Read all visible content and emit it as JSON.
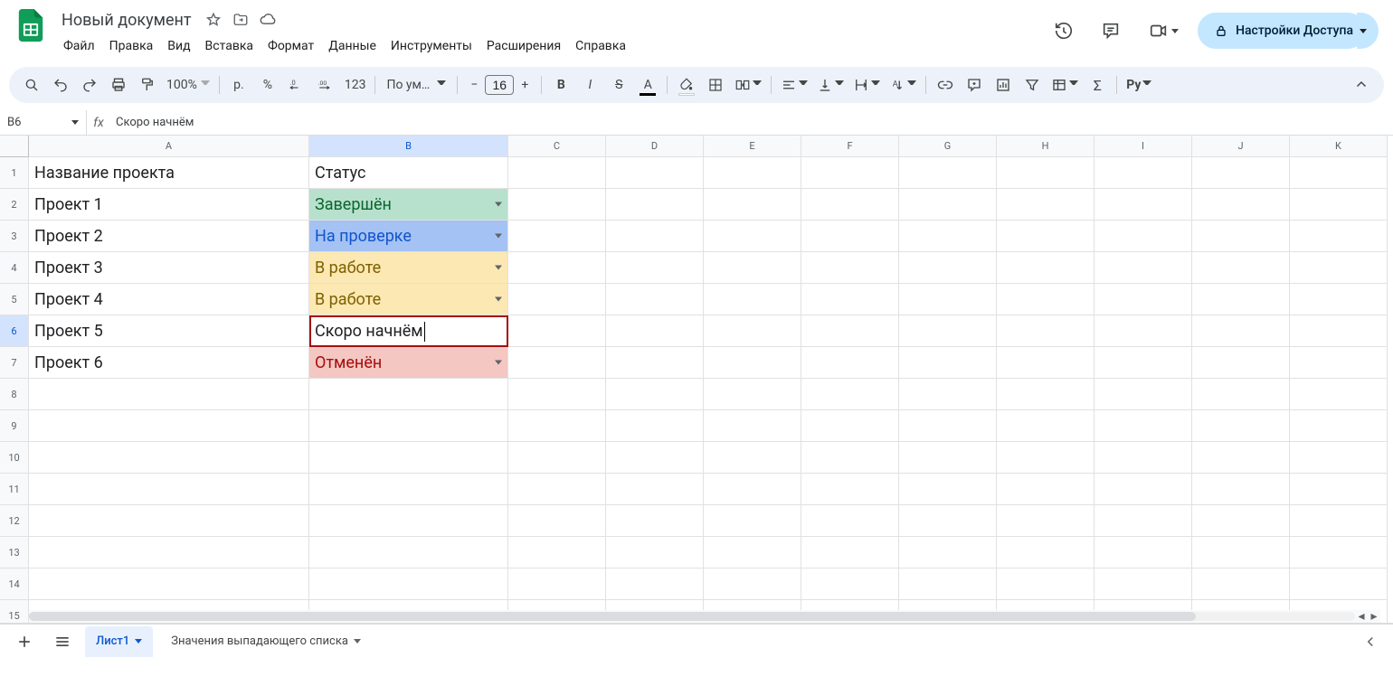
{
  "doc": {
    "title": "Новый документ"
  },
  "menu": [
    "Файл",
    "Правка",
    "Вид",
    "Вставка",
    "Формат",
    "Данные",
    "Инструменты",
    "Расширения",
    "Справка"
  ],
  "share": {
    "label": "Настройки Доступа"
  },
  "toolbar": {
    "zoom": "100%",
    "currency": "р.",
    "percent": "%",
    "dec_dec": ".0",
    "inc_dec": ".00",
    "num_fmt": "123",
    "font": "По ум…",
    "font_size": "16",
    "py": "Py"
  },
  "name_box": "B6",
  "formula": "Скоро начнём",
  "columns": [
    "A",
    "B",
    "C",
    "D",
    "E",
    "F",
    "G",
    "H",
    "I",
    "J",
    "K"
  ],
  "selected_col": "B",
  "selected_row": 6,
  "rows": [
    {
      "n": 1,
      "a": "Название проекта",
      "b": "Статус",
      "cls": "",
      "dd": false
    },
    {
      "n": 2,
      "a": "Проект 1",
      "b": "Завершён",
      "cls": "bg-green",
      "dd": true
    },
    {
      "n": 3,
      "a": "Проект 2",
      "b": "На проверке",
      "cls": "bg-blue",
      "dd": true
    },
    {
      "n": 4,
      "a": "Проект 3",
      "b": "В работе",
      "cls": "bg-yellow",
      "dd": true
    },
    {
      "n": 5,
      "a": "Проект 4",
      "b": "В работе",
      "cls": "bg-yellow",
      "dd": true
    },
    {
      "n": 6,
      "a": "Проект 5",
      "b": "Скоро начнём",
      "cls": "editing",
      "dd": false
    },
    {
      "n": 7,
      "a": "Проект 6",
      "b": "Отменён",
      "cls": "bg-red",
      "dd": true
    }
  ],
  "empty_rows": [
    8,
    9,
    10,
    11,
    12,
    13,
    14,
    15
  ],
  "sheets": {
    "active": "Лист1",
    "named": "Значения выпадающего списка"
  }
}
